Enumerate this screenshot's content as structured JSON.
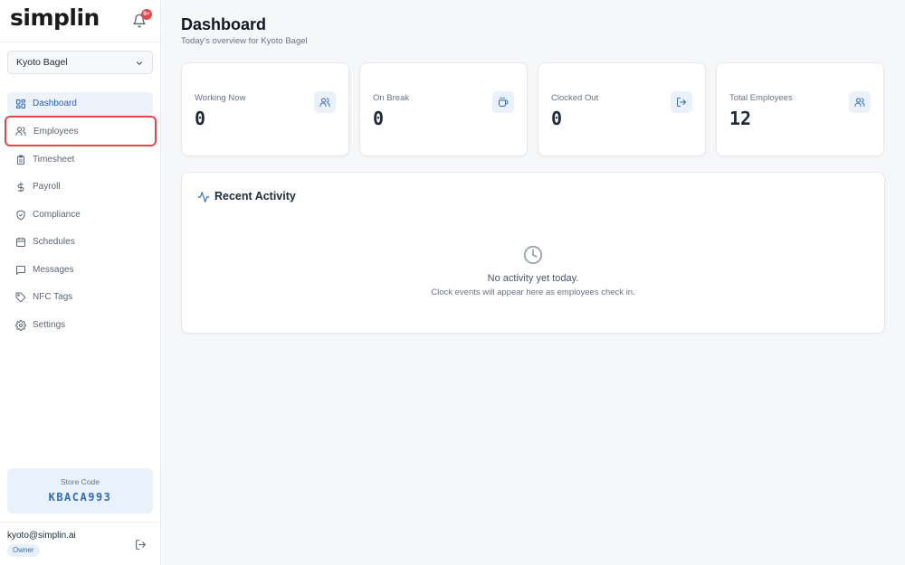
{
  "brand": {
    "name": "simplin",
    "notification_badge": "9+"
  },
  "store_selector": {
    "value": "Kyoto Bagel"
  },
  "nav": {
    "items": [
      {
        "label": "Dashboard",
        "icon": "dashboard-icon",
        "active": true
      },
      {
        "label": "Employees",
        "icon": "users-icon",
        "highlighted": true
      },
      {
        "label": "Timesheet",
        "icon": "clipboard-icon"
      },
      {
        "label": "Payroll",
        "icon": "dollar-icon"
      },
      {
        "label": "Compliance",
        "icon": "shield-icon"
      },
      {
        "label": "Schedules",
        "icon": "calendar-icon"
      },
      {
        "label": "Messages",
        "icon": "message-icon"
      },
      {
        "label": "NFC Tags",
        "icon": "tag-icon"
      },
      {
        "label": "Settings",
        "icon": "gear-icon"
      }
    ]
  },
  "store_code": {
    "caption": "Store Code",
    "value": "KBACA993"
  },
  "user": {
    "email": "kyoto@simplin.ai",
    "role": "Owner"
  },
  "header": {
    "title": "Dashboard",
    "subtitle": "Today's overview for Kyoto Bagel"
  },
  "stats": [
    {
      "label": "Working Now",
      "value": "0",
      "icon": "users-icon"
    },
    {
      "label": "On Break",
      "value": "0",
      "icon": "coffee-icon"
    },
    {
      "label": "Clocked Out",
      "value": "0",
      "icon": "logout-icon"
    },
    {
      "label": "Total Employees",
      "value": "12",
      "icon": "users-icon"
    }
  ],
  "activity": {
    "title": "Recent Activity",
    "empty_title": "No activity yet today.",
    "empty_subtitle": "Clock events will appear here as employees check in."
  },
  "colors": {
    "accent": "#2f6db8",
    "active_bg": "#eef3fb",
    "highlight_border": "#e0474c",
    "badge": "#e5484d"
  }
}
